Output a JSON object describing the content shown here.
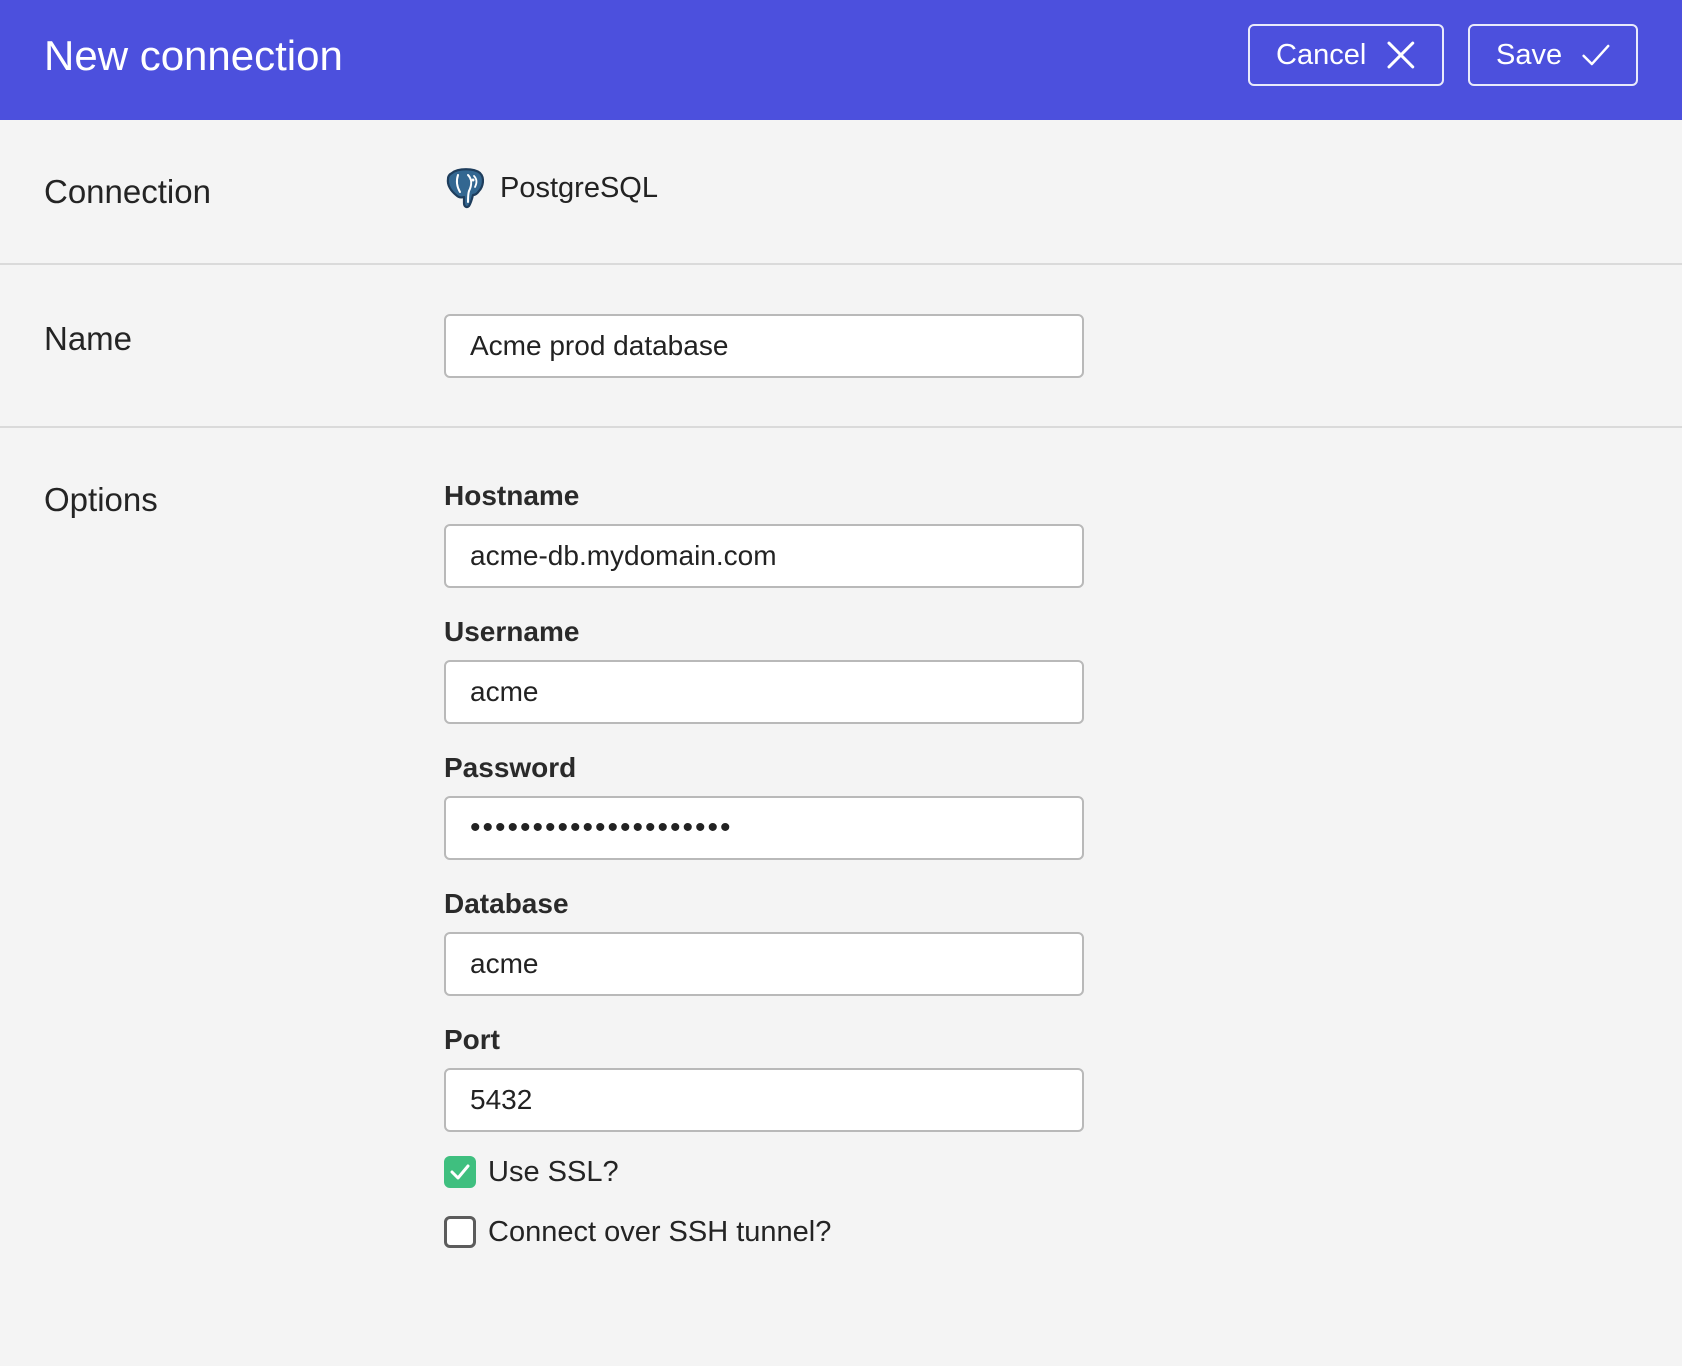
{
  "header": {
    "title": "New connection",
    "cancel_label": "Cancel",
    "save_label": "Save",
    "cancel_icon": "close-icon",
    "save_icon": "check-icon"
  },
  "connection": {
    "label": "Connection",
    "type": "PostgreSQL",
    "type_icon": "postgresql-elephant-icon"
  },
  "name": {
    "label": "Name",
    "value": "Acme prod database"
  },
  "options": {
    "label": "Options",
    "hostname_label": "Hostname",
    "hostname_value": "acme-db.mydomain.com",
    "username_label": "Username",
    "username_value": "acme",
    "password_label": "Password",
    "password_value": "•••••••••••••••••••••",
    "database_label": "Database",
    "database_value": "acme",
    "port_label": "Port",
    "port_value": "5432",
    "ssl_label": "Use SSL?",
    "ssl_checked": true,
    "ssh_label": "Connect over SSH tunnel?",
    "ssh_checked": false
  },
  "colors": {
    "header_bg": "#4c50dd",
    "page_bg": "#f4f4f4",
    "check_green": "#3fbf7f"
  }
}
